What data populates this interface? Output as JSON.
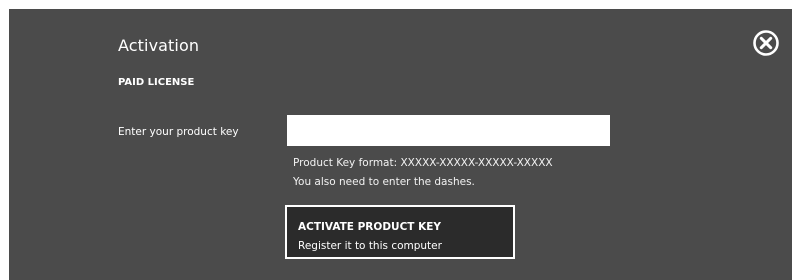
{
  "dialog": {
    "title": "Activation",
    "subtitle": "PAID LICENSE",
    "colors": {
      "background": "#4b4b4b",
      "button_background": "#2b2b2b",
      "text": "#ffffff"
    },
    "close_icon": "close-circle-icon"
  },
  "product_key": {
    "label": "Enter your product key",
    "value": "",
    "placeholder": ""
  },
  "hints": {
    "format": "Product Key format: XXXXX-XXXXX-XXXXX-XXXXX",
    "dashes": "You also need to enter the dashes."
  },
  "activate_button": {
    "title": "ACTIVATE PRODUCT KEY",
    "subtitle": "Register it to this computer"
  }
}
